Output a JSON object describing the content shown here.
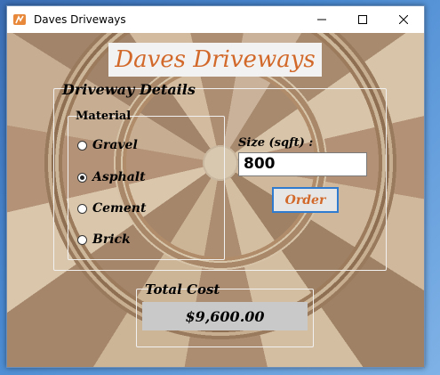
{
  "window": {
    "title": "Daves Driveways"
  },
  "heading": "Daves Driveways",
  "details": {
    "title": "Driveway Details",
    "material": {
      "title": "Material",
      "options": [
        "Gravel",
        "Asphalt",
        "Cement",
        "Brick"
      ],
      "selected": "Asphalt"
    },
    "size": {
      "label": "Size (sqft) :",
      "value": "800"
    },
    "order_label": "Order"
  },
  "total": {
    "title": "Total Cost",
    "value": "$9,600.00"
  },
  "colors": {
    "accent": "#d2692a",
    "button_border": "#2e7bd0"
  }
}
